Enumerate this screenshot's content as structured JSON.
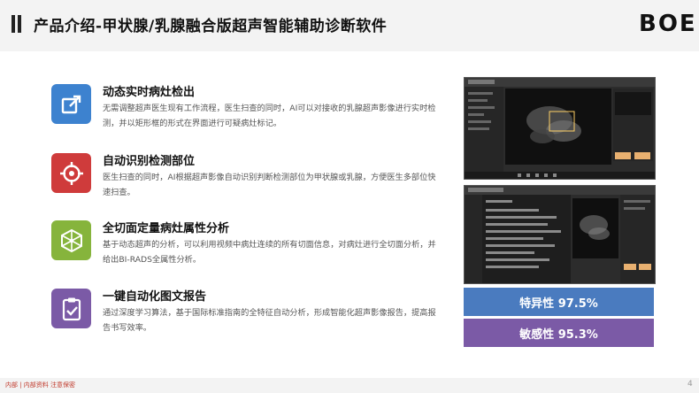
{
  "header": {
    "title": "产品介绍-甲状腺/乳腺融合版超声智能辅助诊断软件",
    "logo": "BOE"
  },
  "features": [
    {
      "title": "动态实时病灶检出",
      "desc": "无需调整超声医生现有工作流程，医生扫查的同时，AI可以对接收的乳腺超声影像进行实时检测，并以矩形框的形式在界面进行可疑病灶标记。",
      "icon": "share-arrow-icon",
      "color": "#3d82cf"
    },
    {
      "title": "自动识别检测部位",
      "desc": "医生扫查的同时，AI根据超声影像自动识别判断检测部位为甲状腺或乳腺，方便医生多部位快速扫查。",
      "icon": "target-icon",
      "color": "#cf3b3b"
    },
    {
      "title": "全切面定量病灶属性分析",
      "desc": "基于动态超声的分析，可以利用视频中病灶连续的所有切面信息，对病灶进行全切面分析，并给出BI-RADS全属性分析。",
      "icon": "hexagon-network-icon",
      "color": "#86b43c"
    },
    {
      "title": "一键自动化图文报告",
      "desc": "通过深度学习算法，基于国际标准指南的全特征自动分析，形成智能化超声影像报告，提高报告书写效率。",
      "icon": "clipboard-check-icon",
      "color": "#7b5aa6"
    }
  ],
  "metrics": [
    {
      "label": "特异性 97.5%",
      "color": "#4a7bbf"
    },
    {
      "label": "敏感性 95.3%",
      "color": "#7b5aa6"
    }
  ],
  "footer": {
    "text": "内部 | 内部资料 注意保密",
    "page": "4"
  }
}
